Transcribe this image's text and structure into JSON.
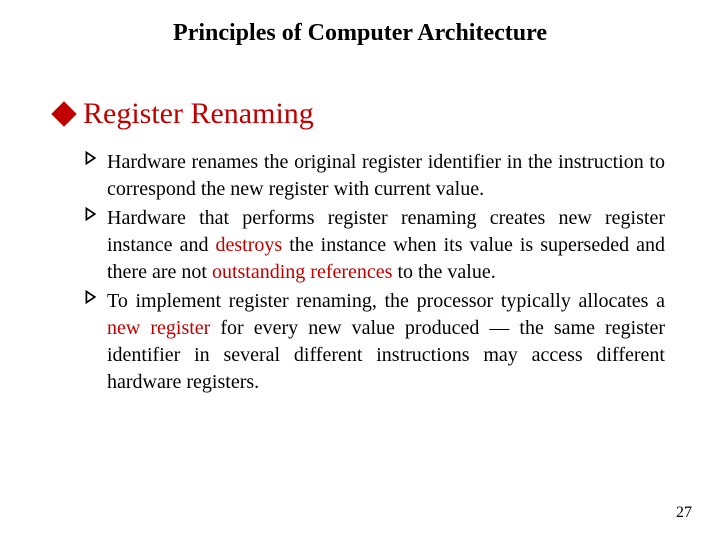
{
  "header": {
    "title": "Principles of Computer Architecture"
  },
  "section": {
    "title": "Register Renaming"
  },
  "bullets": [
    {
      "pre": "Hardware renames the original register identifier in the instruction to correspond the new register with current value."
    },
    {
      "pre": "Hardware that performs register renaming creates new register instance and ",
      "hl1": "destroys",
      "mid": " the instance when its value is superseded and there are not ",
      "hl2": "outstanding references",
      "post": " to the value."
    },
    {
      "pre": "To implement register renaming, the processor typically allocates a ",
      "hl1": "new register",
      "post": " for every new value produced — the same register identifier in several different instructions may access different hardware registers."
    }
  ],
  "page": "27"
}
